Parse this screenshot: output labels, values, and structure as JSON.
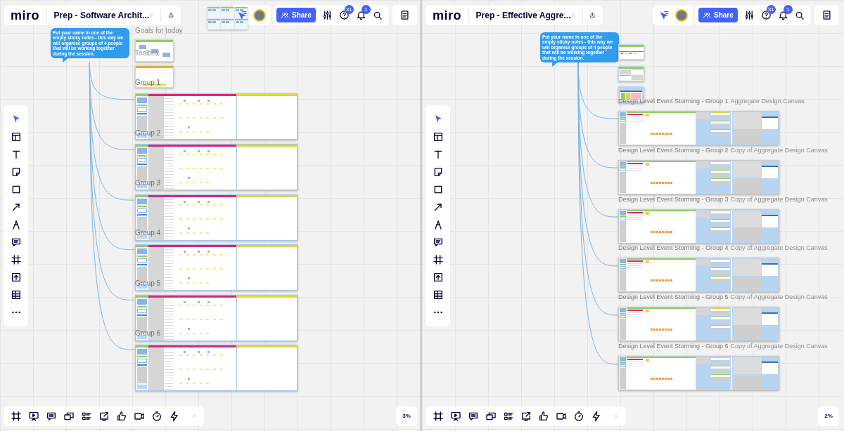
{
  "boards": [
    {
      "kind": "workshop",
      "logo": "miro",
      "title": "Prep - Software Archit...",
      "starred": false,
      "minimap": true,
      "share": "Share",
      "help_badge": "31",
      "notification_badge": "1",
      "zoom": "3%",
      "sticky_note": "Put your name in one of the empty sticky notes - this way we will organise groups of 4 people that will be working together during the session.",
      "tools": [
        {
          "selected": true
        },
        {
          "selected": false
        },
        {
          "selected": false
        },
        {
          "selected": false
        },
        {
          "selected": false
        },
        {
          "selected": false
        },
        {
          "selected": false
        },
        {
          "selected": false
        },
        {
          "selected": false
        },
        {
          "selected": false
        },
        {
          "selected": false
        },
        {
          "selected": false
        }
      ],
      "labels": [
        {
          "title": "Goals for today"
        },
        {
          "title": "Toolbox"
        },
        {
          "title": "Group 1"
        },
        {
          "title": "Group 2"
        },
        {
          "title": "Group 3"
        },
        {
          "title": "Group 4"
        },
        {
          "title": "Group 5"
        },
        {
          "title": "Group 6"
        }
      ]
    },
    {
      "kind": "event_storming",
      "logo": "miro",
      "title": "Prep - Effective Aggre...",
      "starred": false,
      "minimap": false,
      "share": "Share",
      "help_badge": "31",
      "notification_badge": "1",
      "zoom": "2%",
      "sticky_note": "Put your name in one of the empty sticky notes - this way we will organise groups of 4 people that will be working together during the session.",
      "tools": [
        {
          "selected": true
        },
        {
          "selected": false
        },
        {
          "selected": false
        },
        {
          "selected": false
        },
        {
          "selected": false
        },
        {
          "selected": false
        },
        {
          "selected": false
        },
        {
          "selected": false
        },
        {
          "selected": false
        },
        {
          "selected": false
        },
        {
          "selected": false
        },
        {
          "selected": false
        }
      ],
      "labels": [
        {
          "title": "Design Level Event Storming - Group 1",
          "caption": "Aggregate Design Canvas"
        },
        {
          "title": "Design Level Event Storming - Group 2",
          "caption": "Copy of Aggregate Design Canvas"
        },
        {
          "title": "Design Level Event Storming - Group 3",
          "caption": "Copy of Aggregate Design Canvas"
        },
        {
          "title": "Design Level Event Storming - Group 4",
          "caption": "Copy of Aggregate Design Canvas"
        },
        {
          "title": "Design Level Event Storming - Group 5",
          "caption": "Copy of Aggregate Design Canvas"
        },
        {
          "title": "Design Level Event Storming - Group 6",
          "caption": "Copy of Aggregate Design Canvas"
        }
      ]
    }
  ]
}
